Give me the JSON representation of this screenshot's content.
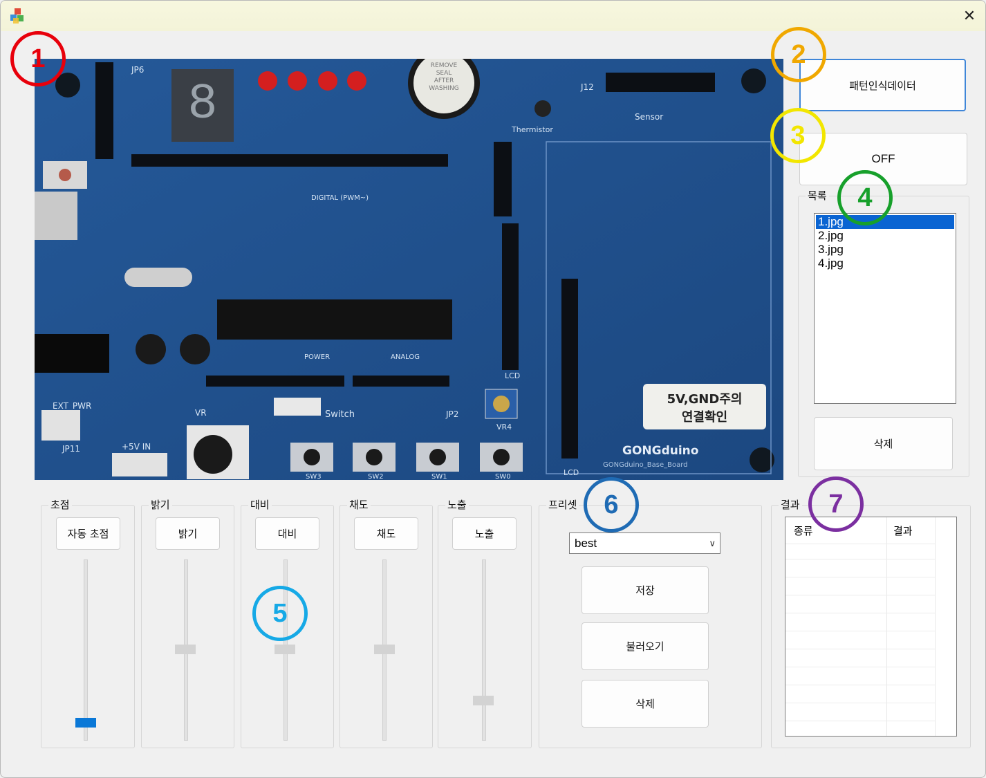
{
  "window": {
    "close_glyph": "✕"
  },
  "camera": {
    "board_labels": {
      "jp6": "JP6",
      "remove_seal": "REMOVE",
      "seal": "SEAL",
      "after": "AFTER",
      "washing": "WASHING",
      "thermistor": "Thermistor",
      "j12": "J12",
      "sensor": "Sensor",
      "digital": "DIGITAL (PWM~)",
      "power": "POWER",
      "analog": "ANALOG",
      "lcd": "LCD",
      "switch": "Switch",
      "jp2": "JP2",
      "vr": "VR",
      "vr4": "VR4",
      "ext_pwr": "EXT_PWR",
      "jp11": "JP11",
      "sv_in": "+5V IN",
      "sw3": "SW3",
      "sw2": "SW2",
      "sw1": "SW1",
      "sw0": "SW0",
      "brand": "GONGduino",
      "brand_sub": "GONGduino_Base_Board",
      "warning_line1": "5V,GND주의",
      "warning_line2": "연결확인"
    }
  },
  "right_panel": {
    "pattern_button": "패턴인식데이터",
    "toggle_button": "OFF",
    "list_group_label": "목록",
    "list_items": [
      "1.jpg",
      "2.jpg",
      "3.jpg",
      "4.jpg"
    ],
    "selected_index": 0,
    "delete_button": "삭제"
  },
  "controls": {
    "focus": {
      "group": "초점",
      "button": "자동 초점",
      "level": 0.07
    },
    "brightness": {
      "group": "밝기",
      "button": "밝기",
      "level": 0.5
    },
    "contrast": {
      "group": "대비",
      "button": "대비",
      "level": 0.5
    },
    "saturation": {
      "group": "채도",
      "button": "채도",
      "level": 0.5
    },
    "exposure": {
      "group": "노출",
      "button": "노출",
      "level": 0.2
    }
  },
  "preset": {
    "group": "프리셋",
    "selected": "best",
    "save_button": "저장",
    "load_button": "불러오기",
    "delete_button": "삭제"
  },
  "result": {
    "group": "결과",
    "columns": [
      "종류",
      "결과"
    ]
  },
  "badges": [
    {
      "label": "1",
      "color": "#e8000b"
    },
    {
      "label": "2",
      "color": "#f0a800"
    },
    {
      "label": "3",
      "color": "#f2e600"
    },
    {
      "label": "4",
      "color": "#17a02b"
    },
    {
      "label": "5",
      "color": "#16a9e6"
    },
    {
      "label": "6",
      "color": "#1f6bb4"
    },
    {
      "label": "7",
      "color": "#7b2fa0"
    }
  ],
  "colors": {
    "accent": "#0a64d2",
    "slider_active": "#0a78d7",
    "pcb": "#1e4b86"
  }
}
